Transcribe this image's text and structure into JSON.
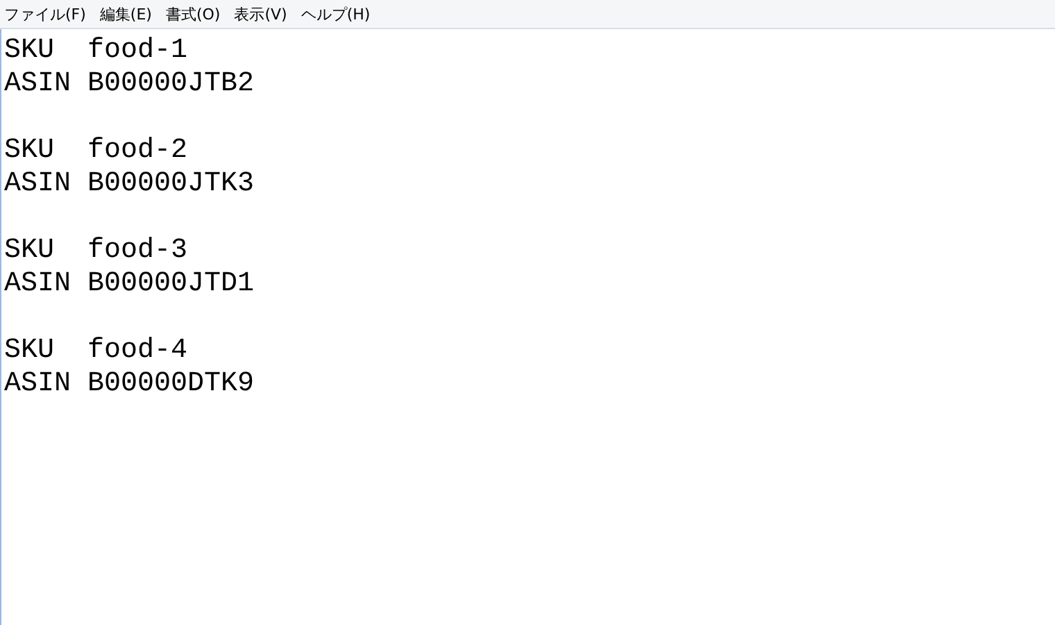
{
  "menu_bar": {
    "items": [
      "ファイル(F)",
      "編集(E)",
      "書式(O)",
      "表示(V)",
      "ヘルプ(H)"
    ]
  },
  "editor": {
    "paragraphs": [
      [
        "SKU  food-1",
        "ASIN B00000JTB2"
      ],
      [
        "SKU  food-2",
        "ASIN B00000JTK3"
      ],
      [
        "SKU  food-3",
        "ASIN B00000JTD1"
      ],
      [
        "SKU  food-4",
        "ASIN B00000DTK9"
      ]
    ]
  }
}
